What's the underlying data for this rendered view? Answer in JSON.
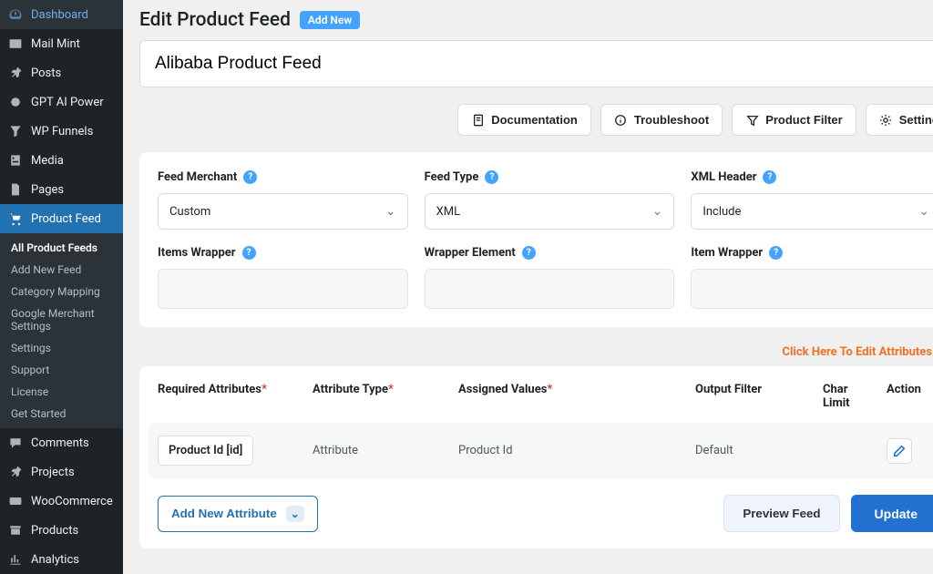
{
  "sidebar": {
    "dashboard": "Dashboard",
    "mailmint": "Mail Mint",
    "posts": "Posts",
    "gptai": "GPT AI Power",
    "wpfunnels": "WP Funnels",
    "media": "Media",
    "pages": "Pages",
    "productfeed": "Product Feed",
    "comments": "Comments",
    "projects": "Projects",
    "woocommerce": "WooCommerce",
    "products": "Products",
    "analytics": "Analytics",
    "sub": {
      "all": "All Product Feeds",
      "addnew": "Add New Feed",
      "catmap": "Category Mapping",
      "gms": "Google Merchant Settings",
      "settings": "Settings",
      "support": "Support",
      "license": "License",
      "getstarted": "Get Started"
    }
  },
  "header": {
    "title": "Edit Product Feed",
    "badge": "Add New"
  },
  "feedTitle": "Alibaba Product Feed",
  "toolbar": {
    "doc": "Documentation",
    "trouble": "Troubleshoot",
    "filter": "Product Filter",
    "settings": "Settings"
  },
  "form": {
    "merchant": {
      "label": "Feed Merchant",
      "value": "Custom"
    },
    "feedtype": {
      "label": "Feed Type",
      "value": "XML"
    },
    "xmlheader": {
      "label": "XML Header",
      "value": "Include"
    },
    "itemswrapper": {
      "label": "Items Wrapper"
    },
    "wrapperel": {
      "label": "Wrapper Element"
    },
    "itemwrapper": {
      "label": "Item Wrapper"
    }
  },
  "hint": "Click Here To Edit Attributes",
  "table": {
    "headers": {
      "required": "Required Attributes",
      "attrtype": "Attribute Type",
      "assigned": "Assigned Values",
      "output": "Output Filter",
      "charlimit": "Char Limit",
      "action": "Action"
    },
    "row": {
      "required": "Product Id [id]",
      "attrtype": "Attribute",
      "assigned": "Product Id",
      "output": "Default"
    }
  },
  "footer": {
    "addnew": "Add New Attribute",
    "preview": "Preview Feed",
    "update": "Update"
  }
}
